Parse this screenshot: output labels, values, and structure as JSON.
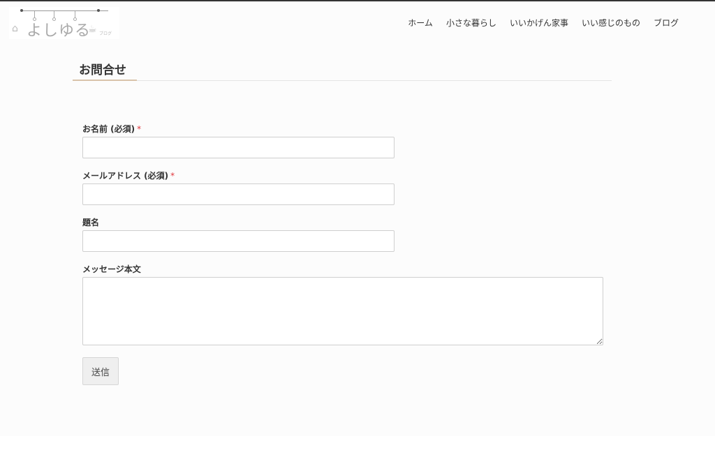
{
  "header": {
    "logo_text": "よしゆる",
    "logo_sub": "ブログ",
    "logo_icon_left": "house-icon",
    "logo_icon_right": "teapot-icon"
  },
  "nav": {
    "items": [
      {
        "label": "ホーム"
      },
      {
        "label": "小さな暮らし"
      },
      {
        "label": "いいかげん家事"
      },
      {
        "label": "いい感じのもの"
      },
      {
        "label": "ブログ"
      }
    ]
  },
  "page": {
    "title": "お問合せ"
  },
  "form": {
    "name_label": "お名前 (必須)",
    "email_label": "メールアドレス (必須)",
    "subject_label": "題名",
    "message_label": "メッセージ本文",
    "required_mark": "*",
    "name_value": "",
    "email_value": "",
    "subject_value": "",
    "message_value": "",
    "submit_label": "送信"
  },
  "colors": {
    "required": "#e0393e",
    "accent_rule": "#d9c3aa",
    "background": "#fcfcfc"
  }
}
